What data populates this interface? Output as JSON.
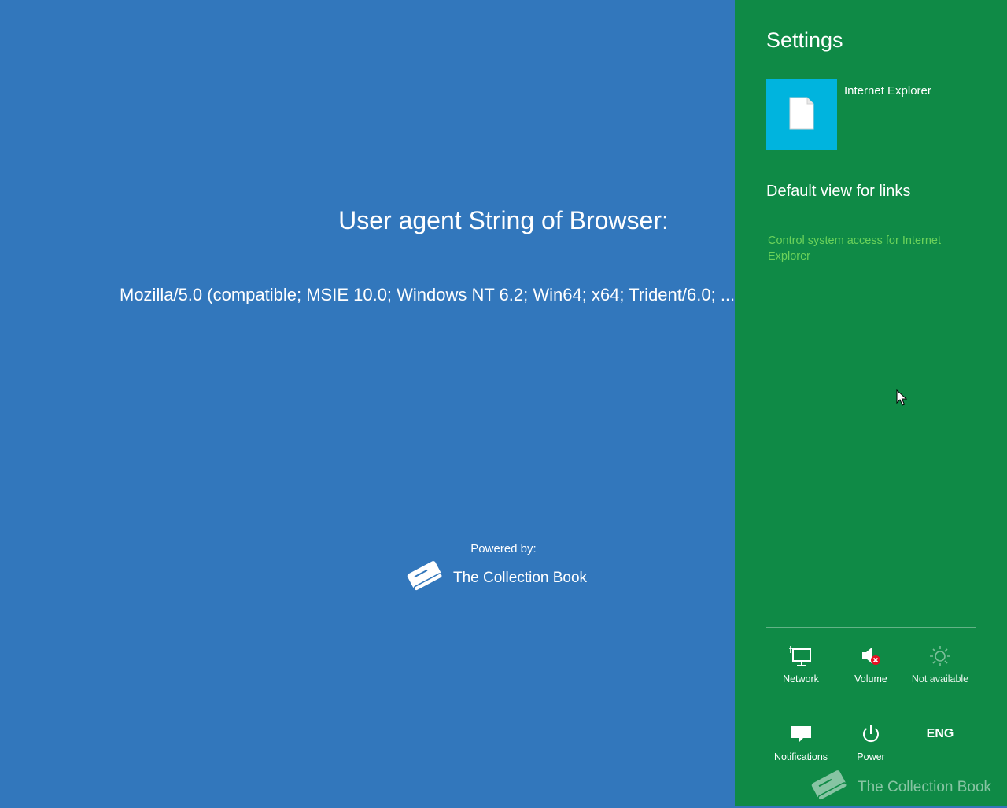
{
  "browser_page": {
    "title": "User agent String of Browser:",
    "user_agent": "Mozilla/5.0 (compatible; MSIE 10.0; Windows NT 6.2; Win64; x64; Trident/6.0; ...",
    "powered_by": "Powered by:",
    "brand": "The Collection Book"
  },
  "settings_charm": {
    "title": "Settings",
    "app_name": "Internet Explorer",
    "links": [
      "Default view for links",
      "Control system access for Internet Explorer"
    ],
    "quick_settings": [
      {
        "label": "Network",
        "icon": "network-icon"
      },
      {
        "label": "Volume",
        "icon": "volume-muted-icon"
      },
      {
        "label": "Not available",
        "icon": "brightness-icon"
      },
      {
        "label": "Notifications",
        "icon": "notifications-icon"
      },
      {
        "label": "Power",
        "icon": "power-icon"
      },
      {
        "label": "ENG",
        "icon": "keyboard-language"
      }
    ]
  },
  "watermark": "The Collection Book",
  "colors": {
    "page_background": "#3277bc",
    "charm_background": "#0f8a46",
    "app_tile": "#00b4de",
    "link_accent": "#6bd25a"
  }
}
